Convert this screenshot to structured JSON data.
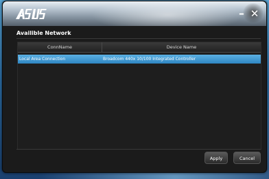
{
  "window": {
    "brand_logo": "ASUS",
    "minimize_icon": "minimize-icon",
    "close_icon": "close-icon"
  },
  "section": {
    "title": "Availible Network"
  },
  "table": {
    "columns": [
      "ConnName",
      "Device Name"
    ],
    "rows": [
      {
        "conn_name": "Local Area Connection",
        "device_name": "Broadcom 440x 10/100 Integrated Controller",
        "selected": true
      }
    ]
  },
  "buttons": {
    "apply": "Apply",
    "cancel": "Cancel"
  },
  "colors": {
    "selection": "#3a93cf",
    "window_bg": "#1b1b1b"
  }
}
